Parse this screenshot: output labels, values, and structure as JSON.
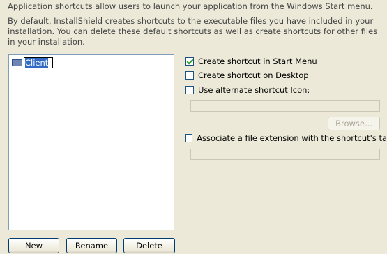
{
  "intro": "Application shortcuts allow users to launch your application from the Windows Start menu.",
  "description": "By default, InstallShield creates shortcuts to the executable files you have included in your installation. You can delete these default shortcuts as well as create shortcuts for other files in your installation.",
  "tree": {
    "items": [
      {
        "label": "Client",
        "editing": true
      }
    ]
  },
  "buttons": {
    "new": "New",
    "rename": "Rename",
    "delete": "Delete",
    "browse": "Browse..."
  },
  "options": {
    "start_menu": {
      "label": "Create shortcut in Start Menu",
      "checked": true
    },
    "desktop": {
      "label": "Create shortcut on Desktop",
      "checked": false
    },
    "alt_icon": {
      "label": "Use alternate shortcut Icon:",
      "checked": false,
      "value": ""
    },
    "file_ext": {
      "label": "Associate a file extension with the shortcut's ta",
      "checked": false,
      "value": ""
    }
  }
}
